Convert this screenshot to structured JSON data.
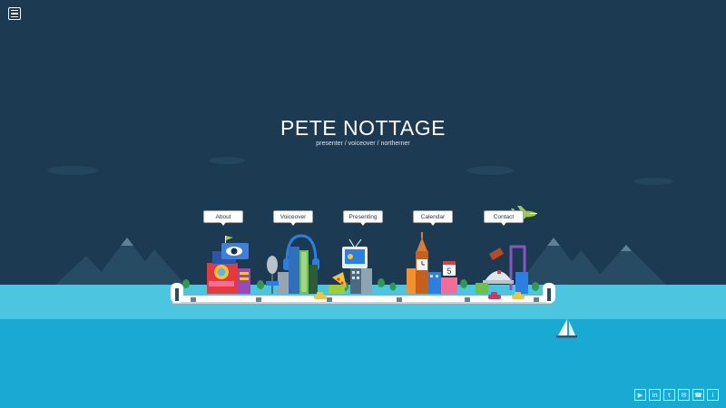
{
  "header": {
    "title": "PETE NOTTAGE",
    "subtitle": "presenter / voiceover / northerner"
  },
  "nav": {
    "items": [
      {
        "label": "About"
      },
      {
        "label": "Voiceover"
      },
      {
        "label": "Presenting"
      },
      {
        "label": "Calendar"
      },
      {
        "label": "Contact"
      }
    ]
  },
  "scene": {
    "calendar_day": "5",
    "colors": {
      "sky": "#1c3a52",
      "sea_upper": "#4cc5e0",
      "sea_lower": "#19a9d3",
      "mountain": "#264b63",
      "accent_green": "#9ccd3c"
    }
  },
  "social": [
    {
      "icon": "play-icon",
      "glyph": "▶"
    },
    {
      "icon": "linkedin-icon",
      "glyph": "in"
    },
    {
      "icon": "twitter-icon",
      "glyph": "t"
    },
    {
      "icon": "email-icon",
      "glyph": "✉"
    },
    {
      "icon": "phone-icon",
      "glyph": "☎"
    },
    {
      "icon": "info-icon",
      "glyph": "i"
    }
  ]
}
